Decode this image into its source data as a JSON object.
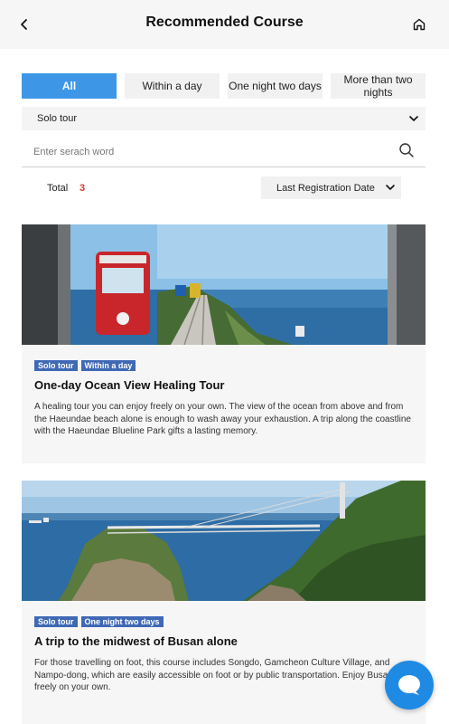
{
  "header": {
    "title": "Recommended Course",
    "back_icon": "back-arrow-icon",
    "home_icon": "home-icon"
  },
  "tabs": [
    {
      "label": "All",
      "active": true
    },
    {
      "label": "Within a day",
      "active": false
    },
    {
      "label": "One night two days",
      "active": false
    },
    {
      "label": "More than two nights",
      "active": false
    }
  ],
  "tour_type_select": {
    "value": "Solo tour"
  },
  "search": {
    "placeholder": "Enter serach word"
  },
  "total": {
    "label": "Total",
    "count": "3"
  },
  "sort": {
    "value": "Last Registration Date"
  },
  "courses": [
    {
      "tags": [
        "Solo tour",
        "Within a day"
      ],
      "title": "One-day Ocean View Healing Tour",
      "description": "A healing tour you can enjoy freely on your own. The view of the ocean from above and from the Haeundae beach alone is enough to wash away your exhaustion. A trip along the coastline with the Haeundae Blueline Park gifts a lasting memory."
    },
    {
      "tags": [
        "Solo tour",
        "One night two days"
      ],
      "title": "A trip to the midwest of Busan alone",
      "description": "For those travelling on foot, this course includes Songdo, Gamcheon Culture Village, and Nampo-dong, which are easily accessible on foot or by public transportation. Enjoy Busan freely on your own."
    }
  ],
  "colors": {
    "accent": "#3d97e6",
    "tag": "#3f69b5",
    "count": "#e0362c",
    "chat_button": "#1f8ae3"
  },
  "chat_icon": "chat-bubble-icon"
}
